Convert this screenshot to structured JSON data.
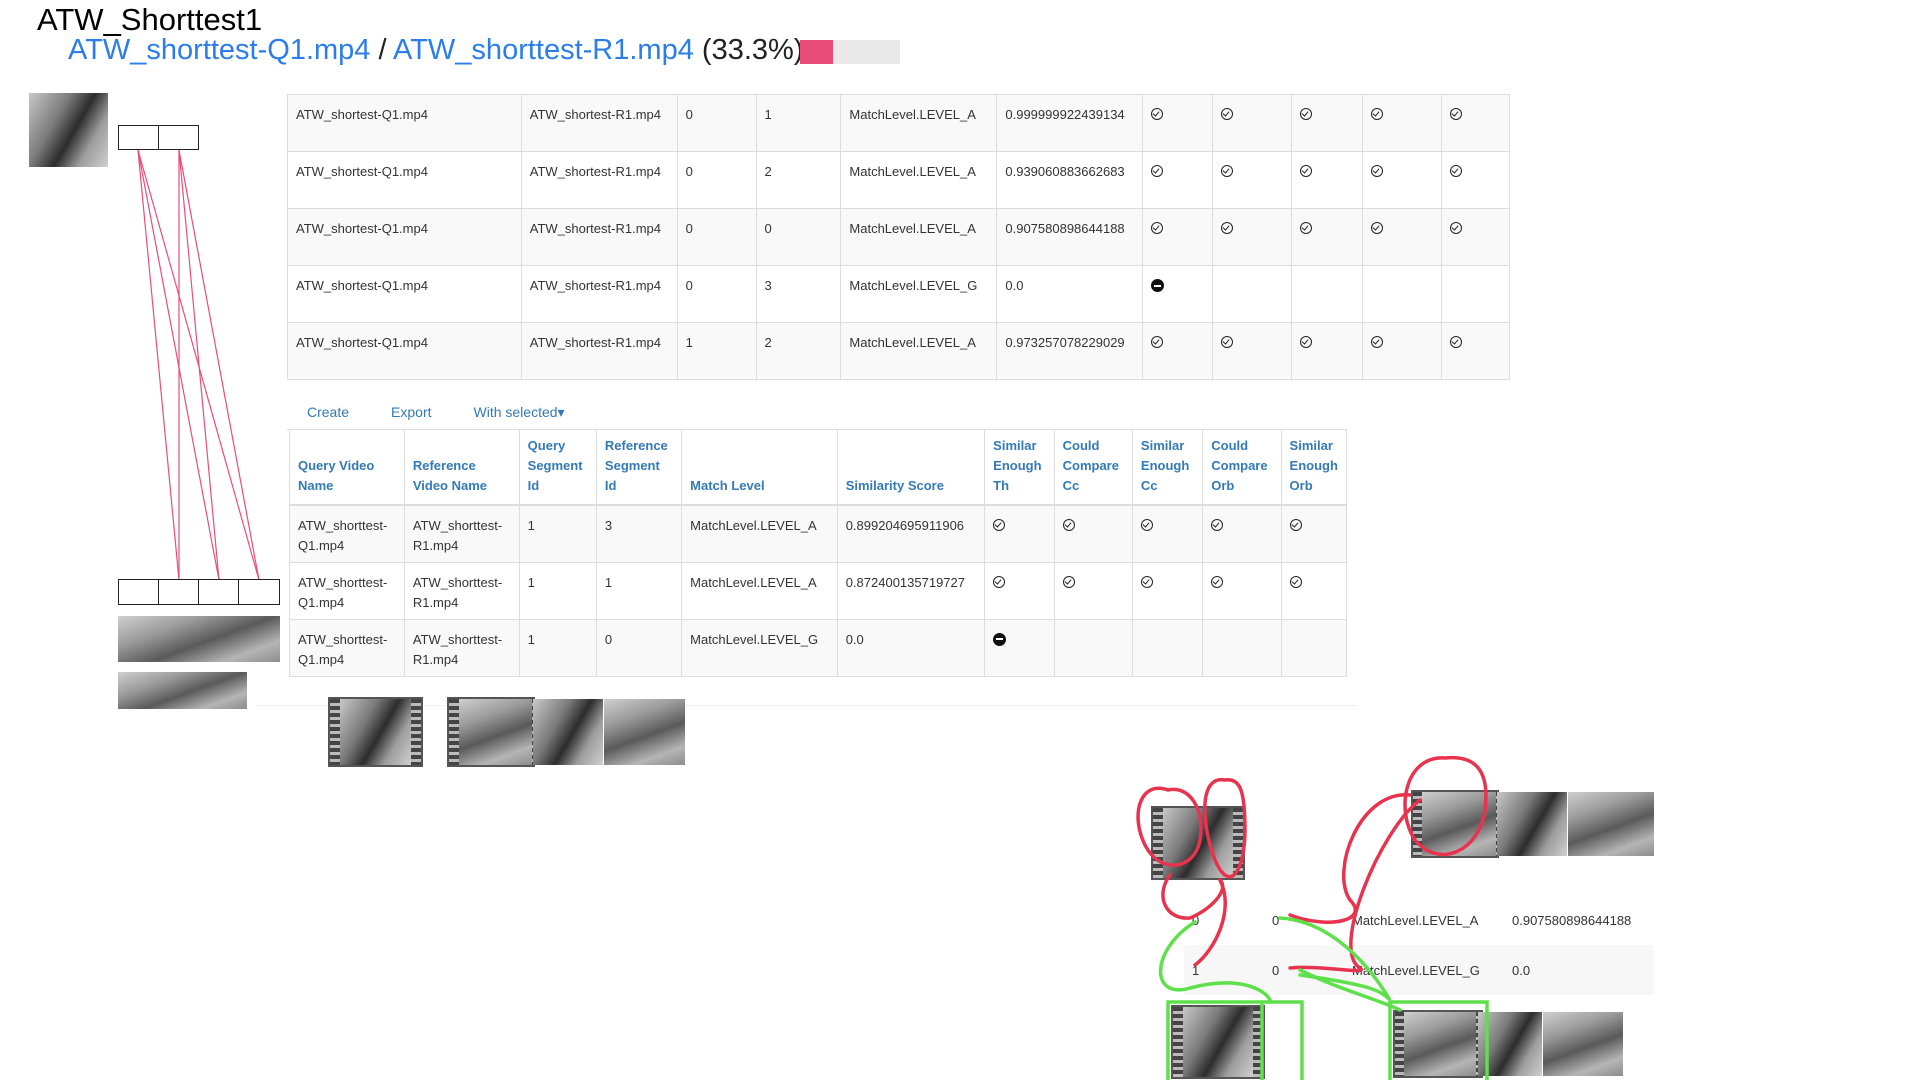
{
  "page": {
    "title": "ATW_Shorttest1",
    "query_link": "ATW_shorttest-Q1.mp4",
    "separator": "/",
    "reference_link": "ATW_shorttest-R1.mp4",
    "match_percent_text": "(33.3%)",
    "progress": 0.333,
    "accent_color": "#ea4c7a",
    "link_color": "#2b7de9"
  },
  "top_table": {
    "rows": [
      {
        "query": "ATW_shortest-Q1.mp4",
        "reference": "ATW_shortest-R1.mp4",
        "q_seg": "0",
        "r_seg": "1",
        "level": "MatchLevel.LEVEL_A",
        "score": "0.999999922439134",
        "icons": [
          "check",
          "check",
          "check",
          "check",
          "check"
        ]
      },
      {
        "query": "ATW_shortest-Q1.mp4",
        "reference": "ATW_shortest-R1.mp4",
        "q_seg": "0",
        "r_seg": "2",
        "level": "MatchLevel.LEVEL_A",
        "score": "0.939060883662683",
        "icons": [
          "check",
          "check",
          "check",
          "check",
          "check"
        ]
      },
      {
        "query": "ATW_shortest-Q1.mp4",
        "reference": "ATW_shortest-R1.mp4",
        "q_seg": "0",
        "r_seg": "0",
        "level": "MatchLevel.LEVEL_A",
        "score": "0.907580898644188",
        "icons": [
          "check",
          "check",
          "check",
          "check",
          "check"
        ]
      },
      {
        "query": "ATW_shortest-Q1.mp4",
        "reference": "ATW_shortest-R1.mp4",
        "q_seg": "0",
        "r_seg": "3",
        "level": "MatchLevel.LEVEL_G",
        "score": "0.0",
        "icons": [
          "minus",
          "",
          "",
          "",
          ""
        ]
      },
      {
        "query": "ATW_shortest-Q1.mp4",
        "reference": "ATW_shortest-R1.mp4",
        "q_seg": "1",
        "r_seg": "2",
        "level": "MatchLevel.LEVEL_A",
        "score": "0.973257078229029",
        "icons": [
          "check",
          "check",
          "check",
          "check",
          "check"
        ]
      }
    ]
  },
  "toolbar": {
    "create_label": "Create",
    "export_label": "Export",
    "with_selected_label": "With selected▾"
  },
  "main_table": {
    "headers": [
      "Query Video Name",
      "Reference Video Name",
      "Query Segment Id",
      "Reference Segment Id",
      "Match Level",
      "Similarity Score",
      "Similar Enough Th",
      "Could Compare Cc",
      "Similar Enough Cc",
      "Could Compare Orb",
      "Similar Enough Orb"
    ],
    "rows": [
      {
        "query": "ATW_shorttest-Q1.mp4",
        "reference": "ATW_shorttest-R1.mp4",
        "q_seg": "1",
        "r_seg": "3",
        "level": "MatchLevel.LEVEL_A",
        "score": "0.899204695911906",
        "icons": [
          "check",
          "check",
          "check",
          "check",
          "check"
        ]
      },
      {
        "query": "ATW_shorttest-Q1.mp4",
        "reference": "ATW_shorttest-R1.mp4",
        "q_seg": "1",
        "r_seg": "1",
        "level": "MatchLevel.LEVEL_A",
        "score": "0.872400135719727",
        "icons": [
          "check",
          "check",
          "check",
          "check",
          "check"
        ]
      },
      {
        "query": "ATW_shorttest-Q1.mp4",
        "reference": "ATW_shorttest-R1.mp4",
        "q_seg": "1",
        "r_seg": "0",
        "level": "MatchLevel.LEVEL_G",
        "score": "0.0",
        "icons": [
          "minus",
          "",
          "",
          "",
          ""
        ]
      }
    ]
  },
  "detail": {
    "rows": [
      {
        "q_seg": "0",
        "r_seg": "0",
        "level": "MatchLevel.LEVEL_A",
        "score": "0.907580898644188"
      },
      {
        "q_seg": "1",
        "r_seg": "0",
        "level": "MatchLevel.LEVEL_G",
        "score": "0.0"
      }
    ]
  },
  "annotation_colors": {
    "lines": "#ea4c7a",
    "red_circles": "#e8334f",
    "green_outlines": "#5ee04a"
  }
}
